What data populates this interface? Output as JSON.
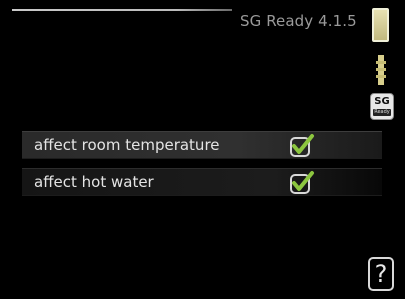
{
  "header": {
    "title": "SG Ready 4.1.5"
  },
  "icons": {
    "scroll": "scroll-indicator-icon",
    "thumb": "scroll-thumb-icon",
    "sg_ready": {
      "name": "sg-ready-icon",
      "top": "SG",
      "bottom": "Ready"
    }
  },
  "rows": [
    {
      "label": "affect room temperature",
      "checked": true,
      "selected": true
    },
    {
      "label": "affect hot water",
      "checked": true,
      "selected": false
    }
  ],
  "help": {
    "label": "?"
  },
  "colors": {
    "background": "#000000",
    "text": "#e4e4e4",
    "title": "#9a9a9a",
    "check_fill": "#8cc63f",
    "check_box": "#d8d8d8"
  }
}
